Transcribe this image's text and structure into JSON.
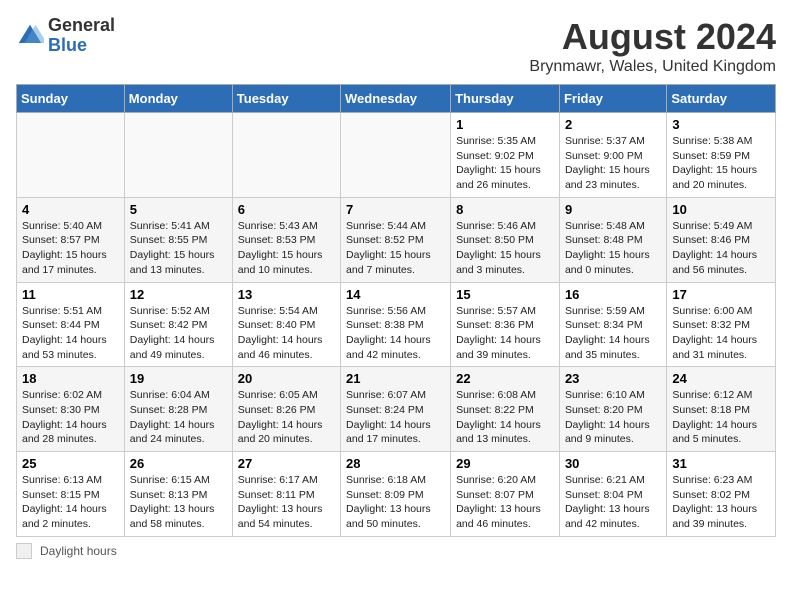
{
  "header": {
    "logo_general": "General",
    "logo_blue": "Blue",
    "month_year": "August 2024",
    "location": "Brynmawr, Wales, United Kingdom"
  },
  "calendar": {
    "days_of_week": [
      "Sunday",
      "Monday",
      "Tuesday",
      "Wednesday",
      "Thursday",
      "Friday",
      "Saturday"
    ],
    "weeks": [
      [
        {
          "day": "",
          "info": ""
        },
        {
          "day": "",
          "info": ""
        },
        {
          "day": "",
          "info": ""
        },
        {
          "day": "",
          "info": ""
        },
        {
          "day": "1",
          "info": "Sunrise: 5:35 AM\nSunset: 9:02 PM\nDaylight: 15 hours and 26 minutes."
        },
        {
          "day": "2",
          "info": "Sunrise: 5:37 AM\nSunset: 9:00 PM\nDaylight: 15 hours and 23 minutes."
        },
        {
          "day": "3",
          "info": "Sunrise: 5:38 AM\nSunset: 8:59 PM\nDaylight: 15 hours and 20 minutes."
        }
      ],
      [
        {
          "day": "4",
          "info": "Sunrise: 5:40 AM\nSunset: 8:57 PM\nDaylight: 15 hours and 17 minutes."
        },
        {
          "day": "5",
          "info": "Sunrise: 5:41 AM\nSunset: 8:55 PM\nDaylight: 15 hours and 13 minutes."
        },
        {
          "day": "6",
          "info": "Sunrise: 5:43 AM\nSunset: 8:53 PM\nDaylight: 15 hours and 10 minutes."
        },
        {
          "day": "7",
          "info": "Sunrise: 5:44 AM\nSunset: 8:52 PM\nDaylight: 15 hours and 7 minutes."
        },
        {
          "day": "8",
          "info": "Sunrise: 5:46 AM\nSunset: 8:50 PM\nDaylight: 15 hours and 3 minutes."
        },
        {
          "day": "9",
          "info": "Sunrise: 5:48 AM\nSunset: 8:48 PM\nDaylight: 15 hours and 0 minutes."
        },
        {
          "day": "10",
          "info": "Sunrise: 5:49 AM\nSunset: 8:46 PM\nDaylight: 14 hours and 56 minutes."
        }
      ],
      [
        {
          "day": "11",
          "info": "Sunrise: 5:51 AM\nSunset: 8:44 PM\nDaylight: 14 hours and 53 minutes."
        },
        {
          "day": "12",
          "info": "Sunrise: 5:52 AM\nSunset: 8:42 PM\nDaylight: 14 hours and 49 minutes."
        },
        {
          "day": "13",
          "info": "Sunrise: 5:54 AM\nSunset: 8:40 PM\nDaylight: 14 hours and 46 minutes."
        },
        {
          "day": "14",
          "info": "Sunrise: 5:56 AM\nSunset: 8:38 PM\nDaylight: 14 hours and 42 minutes."
        },
        {
          "day": "15",
          "info": "Sunrise: 5:57 AM\nSunset: 8:36 PM\nDaylight: 14 hours and 39 minutes."
        },
        {
          "day": "16",
          "info": "Sunrise: 5:59 AM\nSunset: 8:34 PM\nDaylight: 14 hours and 35 minutes."
        },
        {
          "day": "17",
          "info": "Sunrise: 6:00 AM\nSunset: 8:32 PM\nDaylight: 14 hours and 31 minutes."
        }
      ],
      [
        {
          "day": "18",
          "info": "Sunrise: 6:02 AM\nSunset: 8:30 PM\nDaylight: 14 hours and 28 minutes."
        },
        {
          "day": "19",
          "info": "Sunrise: 6:04 AM\nSunset: 8:28 PM\nDaylight: 14 hours and 24 minutes."
        },
        {
          "day": "20",
          "info": "Sunrise: 6:05 AM\nSunset: 8:26 PM\nDaylight: 14 hours and 20 minutes."
        },
        {
          "day": "21",
          "info": "Sunrise: 6:07 AM\nSunset: 8:24 PM\nDaylight: 14 hours and 17 minutes."
        },
        {
          "day": "22",
          "info": "Sunrise: 6:08 AM\nSunset: 8:22 PM\nDaylight: 14 hours and 13 minutes."
        },
        {
          "day": "23",
          "info": "Sunrise: 6:10 AM\nSunset: 8:20 PM\nDaylight: 14 hours and 9 minutes."
        },
        {
          "day": "24",
          "info": "Sunrise: 6:12 AM\nSunset: 8:18 PM\nDaylight: 14 hours and 5 minutes."
        }
      ],
      [
        {
          "day": "25",
          "info": "Sunrise: 6:13 AM\nSunset: 8:15 PM\nDaylight: 14 hours and 2 minutes."
        },
        {
          "day": "26",
          "info": "Sunrise: 6:15 AM\nSunset: 8:13 PM\nDaylight: 13 hours and 58 minutes."
        },
        {
          "day": "27",
          "info": "Sunrise: 6:17 AM\nSunset: 8:11 PM\nDaylight: 13 hours and 54 minutes."
        },
        {
          "day": "28",
          "info": "Sunrise: 6:18 AM\nSunset: 8:09 PM\nDaylight: 13 hours and 50 minutes."
        },
        {
          "day": "29",
          "info": "Sunrise: 6:20 AM\nSunset: 8:07 PM\nDaylight: 13 hours and 46 minutes."
        },
        {
          "day": "30",
          "info": "Sunrise: 6:21 AM\nSunset: 8:04 PM\nDaylight: 13 hours and 42 minutes."
        },
        {
          "day": "31",
          "info": "Sunrise: 6:23 AM\nSunset: 8:02 PM\nDaylight: 13 hours and 39 minutes."
        }
      ]
    ]
  },
  "footer": {
    "legend_label": "Daylight hours"
  }
}
